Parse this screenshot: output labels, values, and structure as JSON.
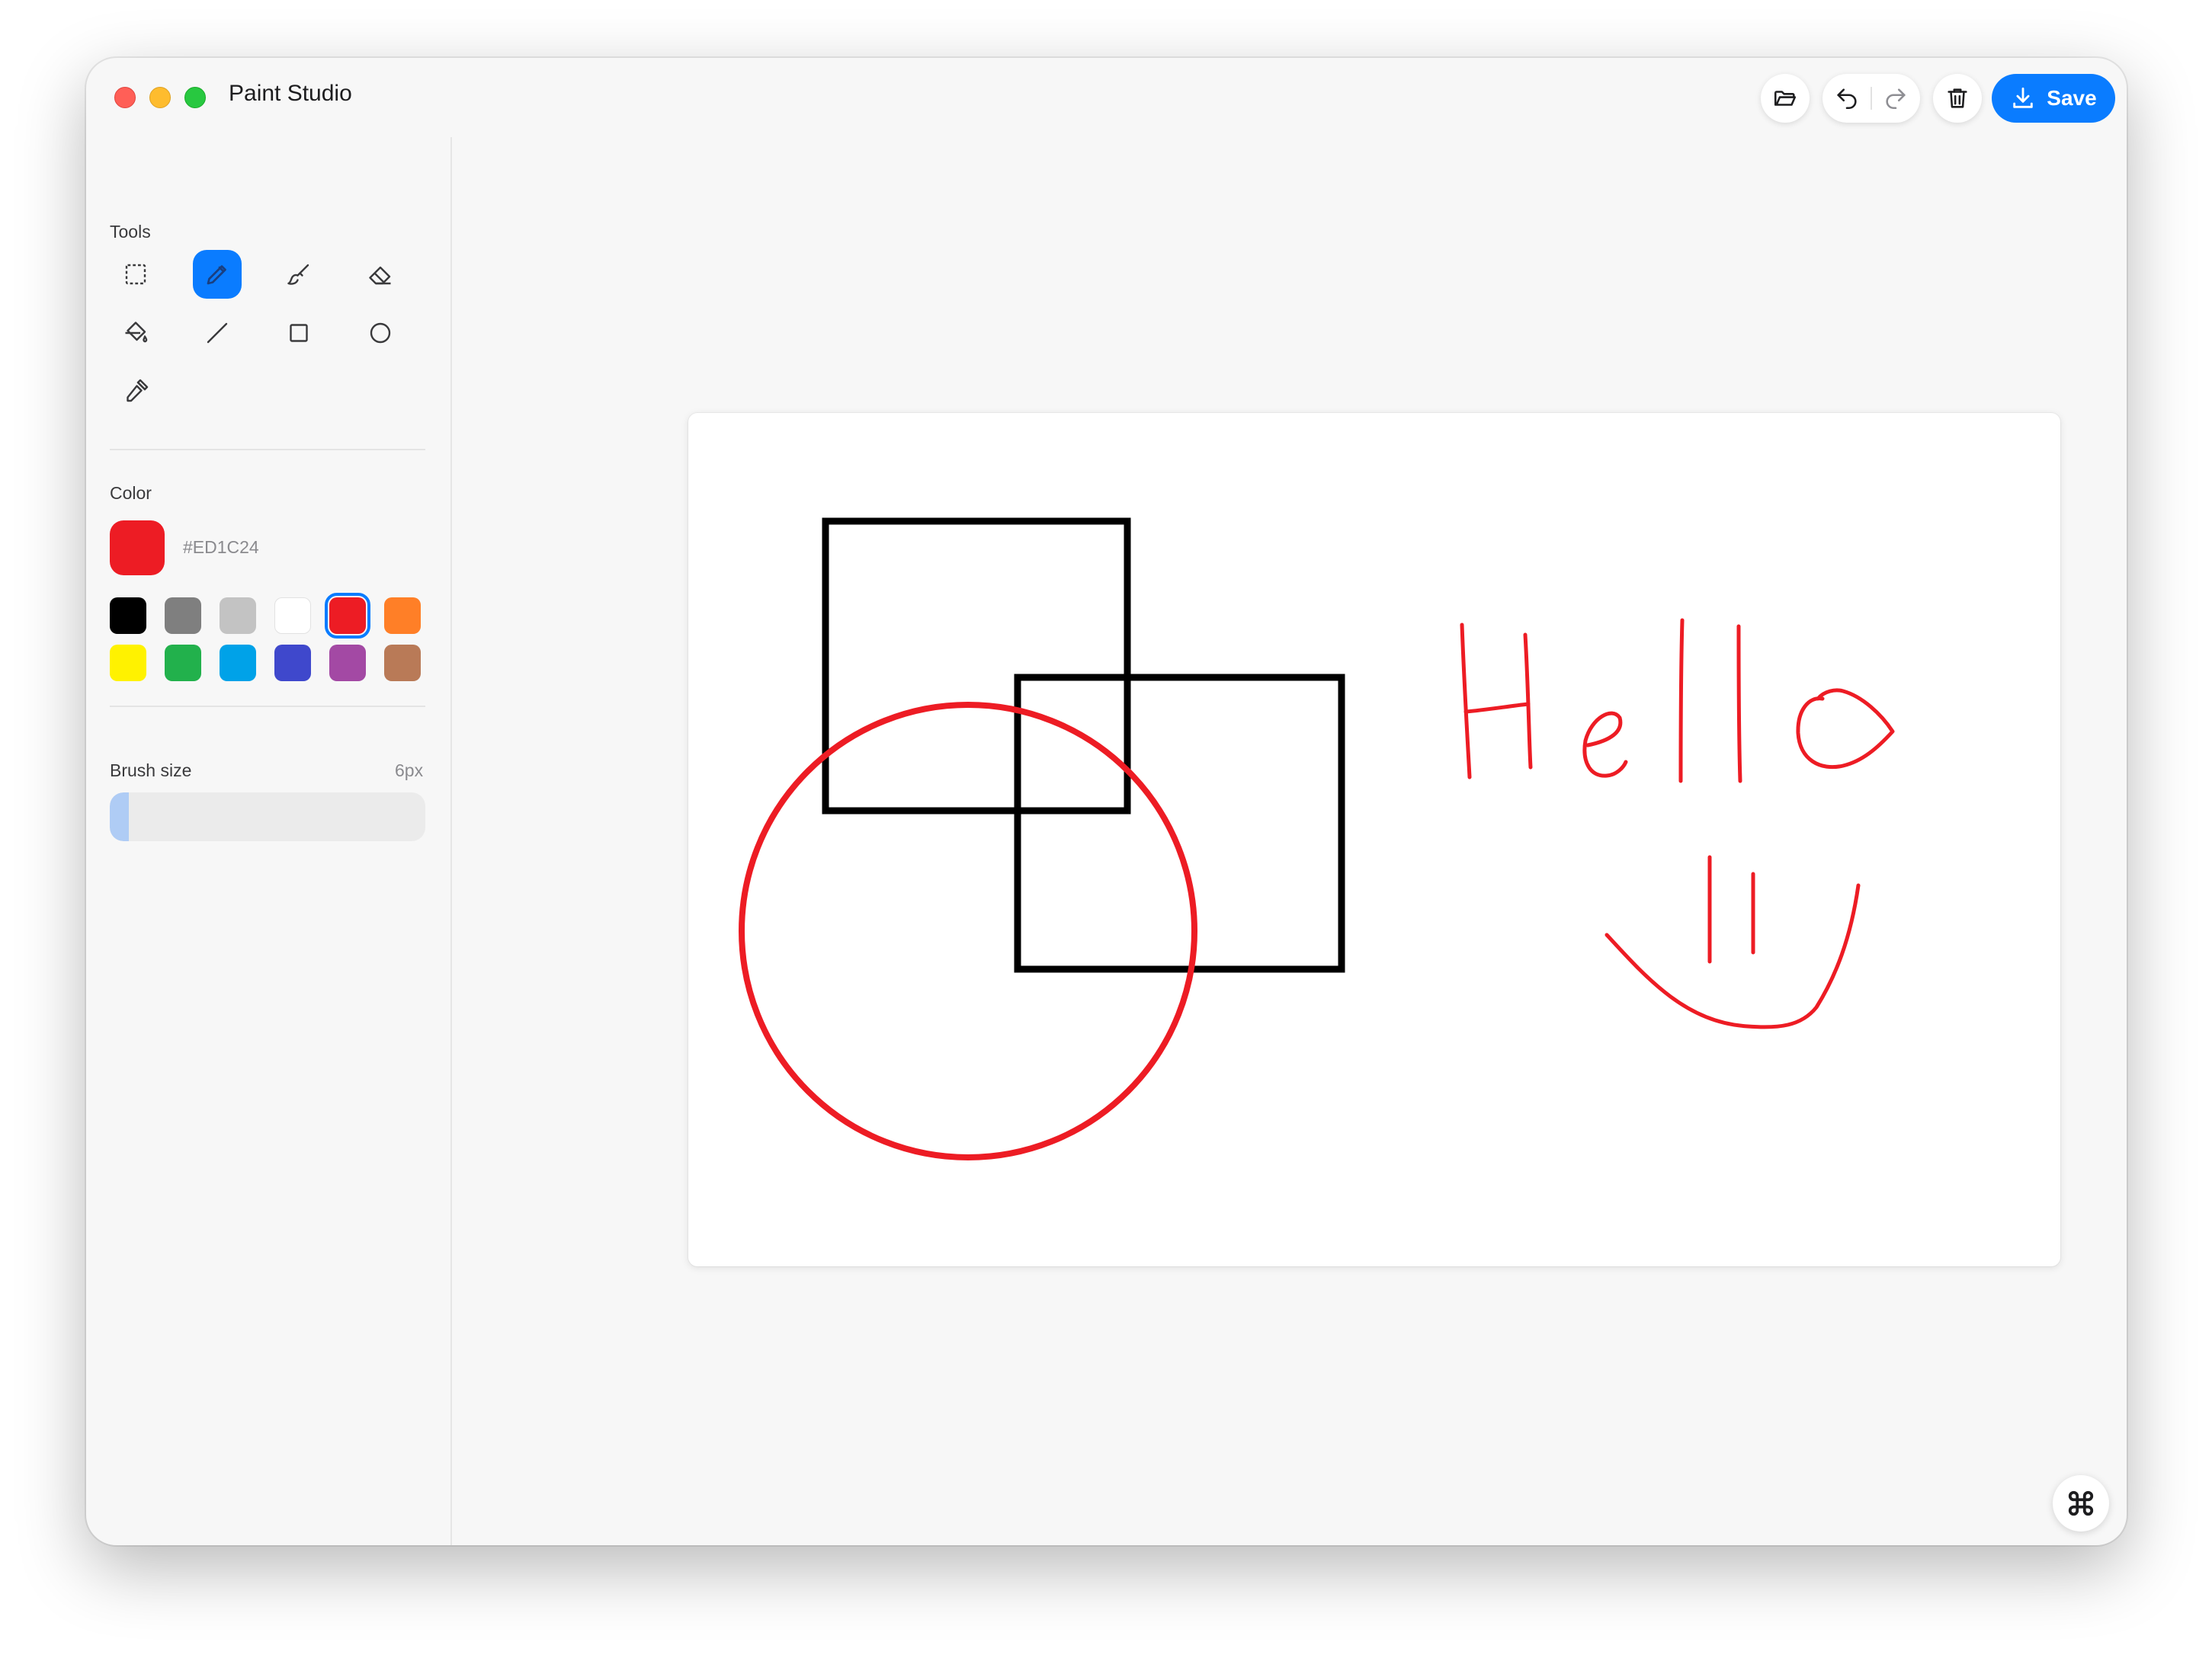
{
  "window": {
    "title": "Paint Studio"
  },
  "toolbar": {
    "open_icon": "folder-open-icon",
    "undo_icon": "undo-icon",
    "redo_icon": "redo-icon",
    "delete_icon": "trash-icon",
    "save_label": "Save",
    "save_icon": "download-icon"
  },
  "sidebar": {
    "tools_label": "Tools",
    "tools": [
      {
        "name": "select",
        "icon": "marquee-select-icon",
        "active": false
      },
      {
        "name": "pencil",
        "icon": "pencil-icon",
        "active": true
      },
      {
        "name": "brush",
        "icon": "brush-icon",
        "active": false
      },
      {
        "name": "eraser",
        "icon": "eraser-icon",
        "active": false
      },
      {
        "name": "fill",
        "icon": "paint-bucket-icon",
        "active": false
      },
      {
        "name": "line",
        "icon": "line-icon",
        "active": false
      },
      {
        "name": "rectangle",
        "icon": "rectangle-icon",
        "active": false
      },
      {
        "name": "ellipse",
        "icon": "circle-icon",
        "active": false
      },
      {
        "name": "eyedropper",
        "icon": "eyedropper-icon",
        "active": false
      }
    ],
    "color_label": "Color",
    "current_color": "#ED1C24",
    "current_color_hex": "#ED1C24",
    "palette": [
      "#000000",
      "#7f7f7f",
      "#c3c3c3",
      "#ffffff",
      "#ED1C24",
      "#ff7f27",
      "#fff200",
      "#22b14c",
      "#00a2e8",
      "#3f48cc",
      "#a349a4",
      "#b97a57"
    ],
    "selected_palette_index": 4,
    "brush_label": "Brush size",
    "brush_value": "6px",
    "brush_fraction": 0.06
  },
  "canvas": {
    "stroke_colors": {
      "black": "#000000",
      "red": "#ED1C24"
    }
  },
  "fab_icon": "command-icon"
}
